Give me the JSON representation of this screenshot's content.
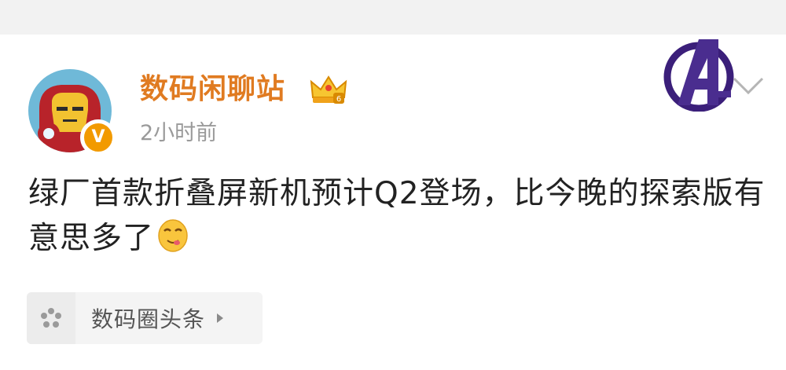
{
  "post": {
    "author": "数码闲聊站",
    "verified_badge": "V",
    "timestamp": "2小时前",
    "text": "绿厂首款折叠屏新机预计Q2登场，比今晚的探索版有意思多了",
    "emoji_icon": "drooling-face-icon"
  },
  "topic_card": {
    "label": "数码圈头条",
    "icon": "pinwheel-icon"
  },
  "colors": {
    "author_name": "#e07b21",
    "badge_orange": "#f29a00",
    "logo_purple": "#3b1f7a"
  }
}
